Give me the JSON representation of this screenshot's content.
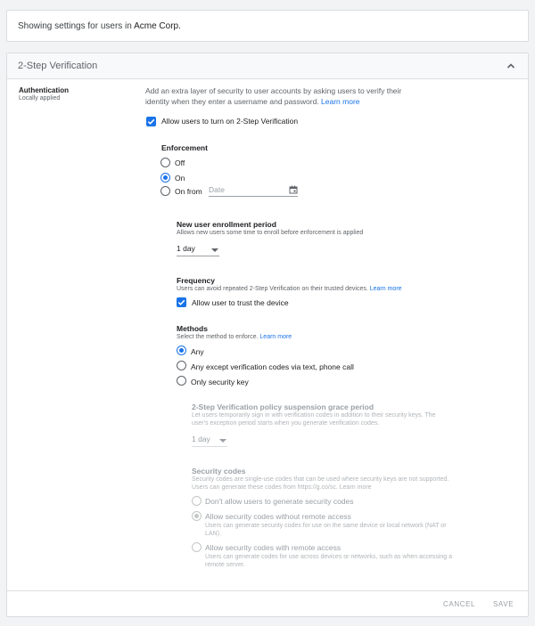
{
  "info": {
    "prefix": "Showing settings for users in ",
    "org": "Acme Corp."
  },
  "section": {
    "title": "2-Step Verification"
  },
  "side": {
    "label": "Authentication",
    "sublabel": "Locally applied"
  },
  "auth": {
    "description": "Add an extra layer of security to user accounts by asking users to verify their identity when they enter a username and password.",
    "learn_more": "Learn more",
    "allow_label": "Allow users to turn on 2-Step Verification"
  },
  "enforcement": {
    "heading": "Enforcement",
    "off": "Off",
    "on": "On",
    "on_from": "On from",
    "date_placeholder": "Date"
  },
  "enrollment": {
    "heading": "New user enrollment period",
    "sub": "Allows new users some time to enroll before enforcement is applied",
    "value": "1 day"
  },
  "frequency": {
    "heading": "Frequency",
    "sub": "Users can avoid repeated 2-Step Verification on their trusted devices.",
    "learn_more": "Learn more",
    "trust_label": "Allow user to trust the device"
  },
  "methods": {
    "heading": "Methods",
    "sub": "Select the method to enforce.",
    "learn_more": "Learn more",
    "any": "Any",
    "any_except": "Any except verification codes via text, phone call",
    "security_key": "Only security key"
  },
  "grace": {
    "heading": "2-Step Verification policy suspension grace period",
    "sub1": "Let users temporarily sign in with verification codes in addition to their security keys. The",
    "sub2": "user's exception period starts when you generate verification codes.",
    "value": "1 day"
  },
  "codes": {
    "heading": "Security codes",
    "sub1": "Security codes are single-use codes that can be used where security keys are not supported.",
    "sub2_prefix": "Users can generate these codes from ",
    "sub2_link": "https://g.co/sc.",
    "learn_more": "Learn more",
    "opt1": "Don't allow users to generate security codes",
    "opt2": "Allow security codes without remote access",
    "opt2_sub1": "Users can generate security codes for use on the same device or local network (NAT or",
    "opt2_sub2": "LAN).",
    "opt3": "Allow security codes with remote access",
    "opt3_sub1": "Users can generate codes for use across devices or networks, such as when accessing a",
    "opt3_sub2": "remote server."
  },
  "footer": {
    "cancel": "CANCEL",
    "save": "SAVE"
  },
  "colors": {
    "accent": "#1a73e8",
    "disabled": "#9aa0a6"
  },
  "icons": {
    "collapse": "chevron-up-icon",
    "calendar": "calendar-icon",
    "check": "checkmark-icon"
  }
}
